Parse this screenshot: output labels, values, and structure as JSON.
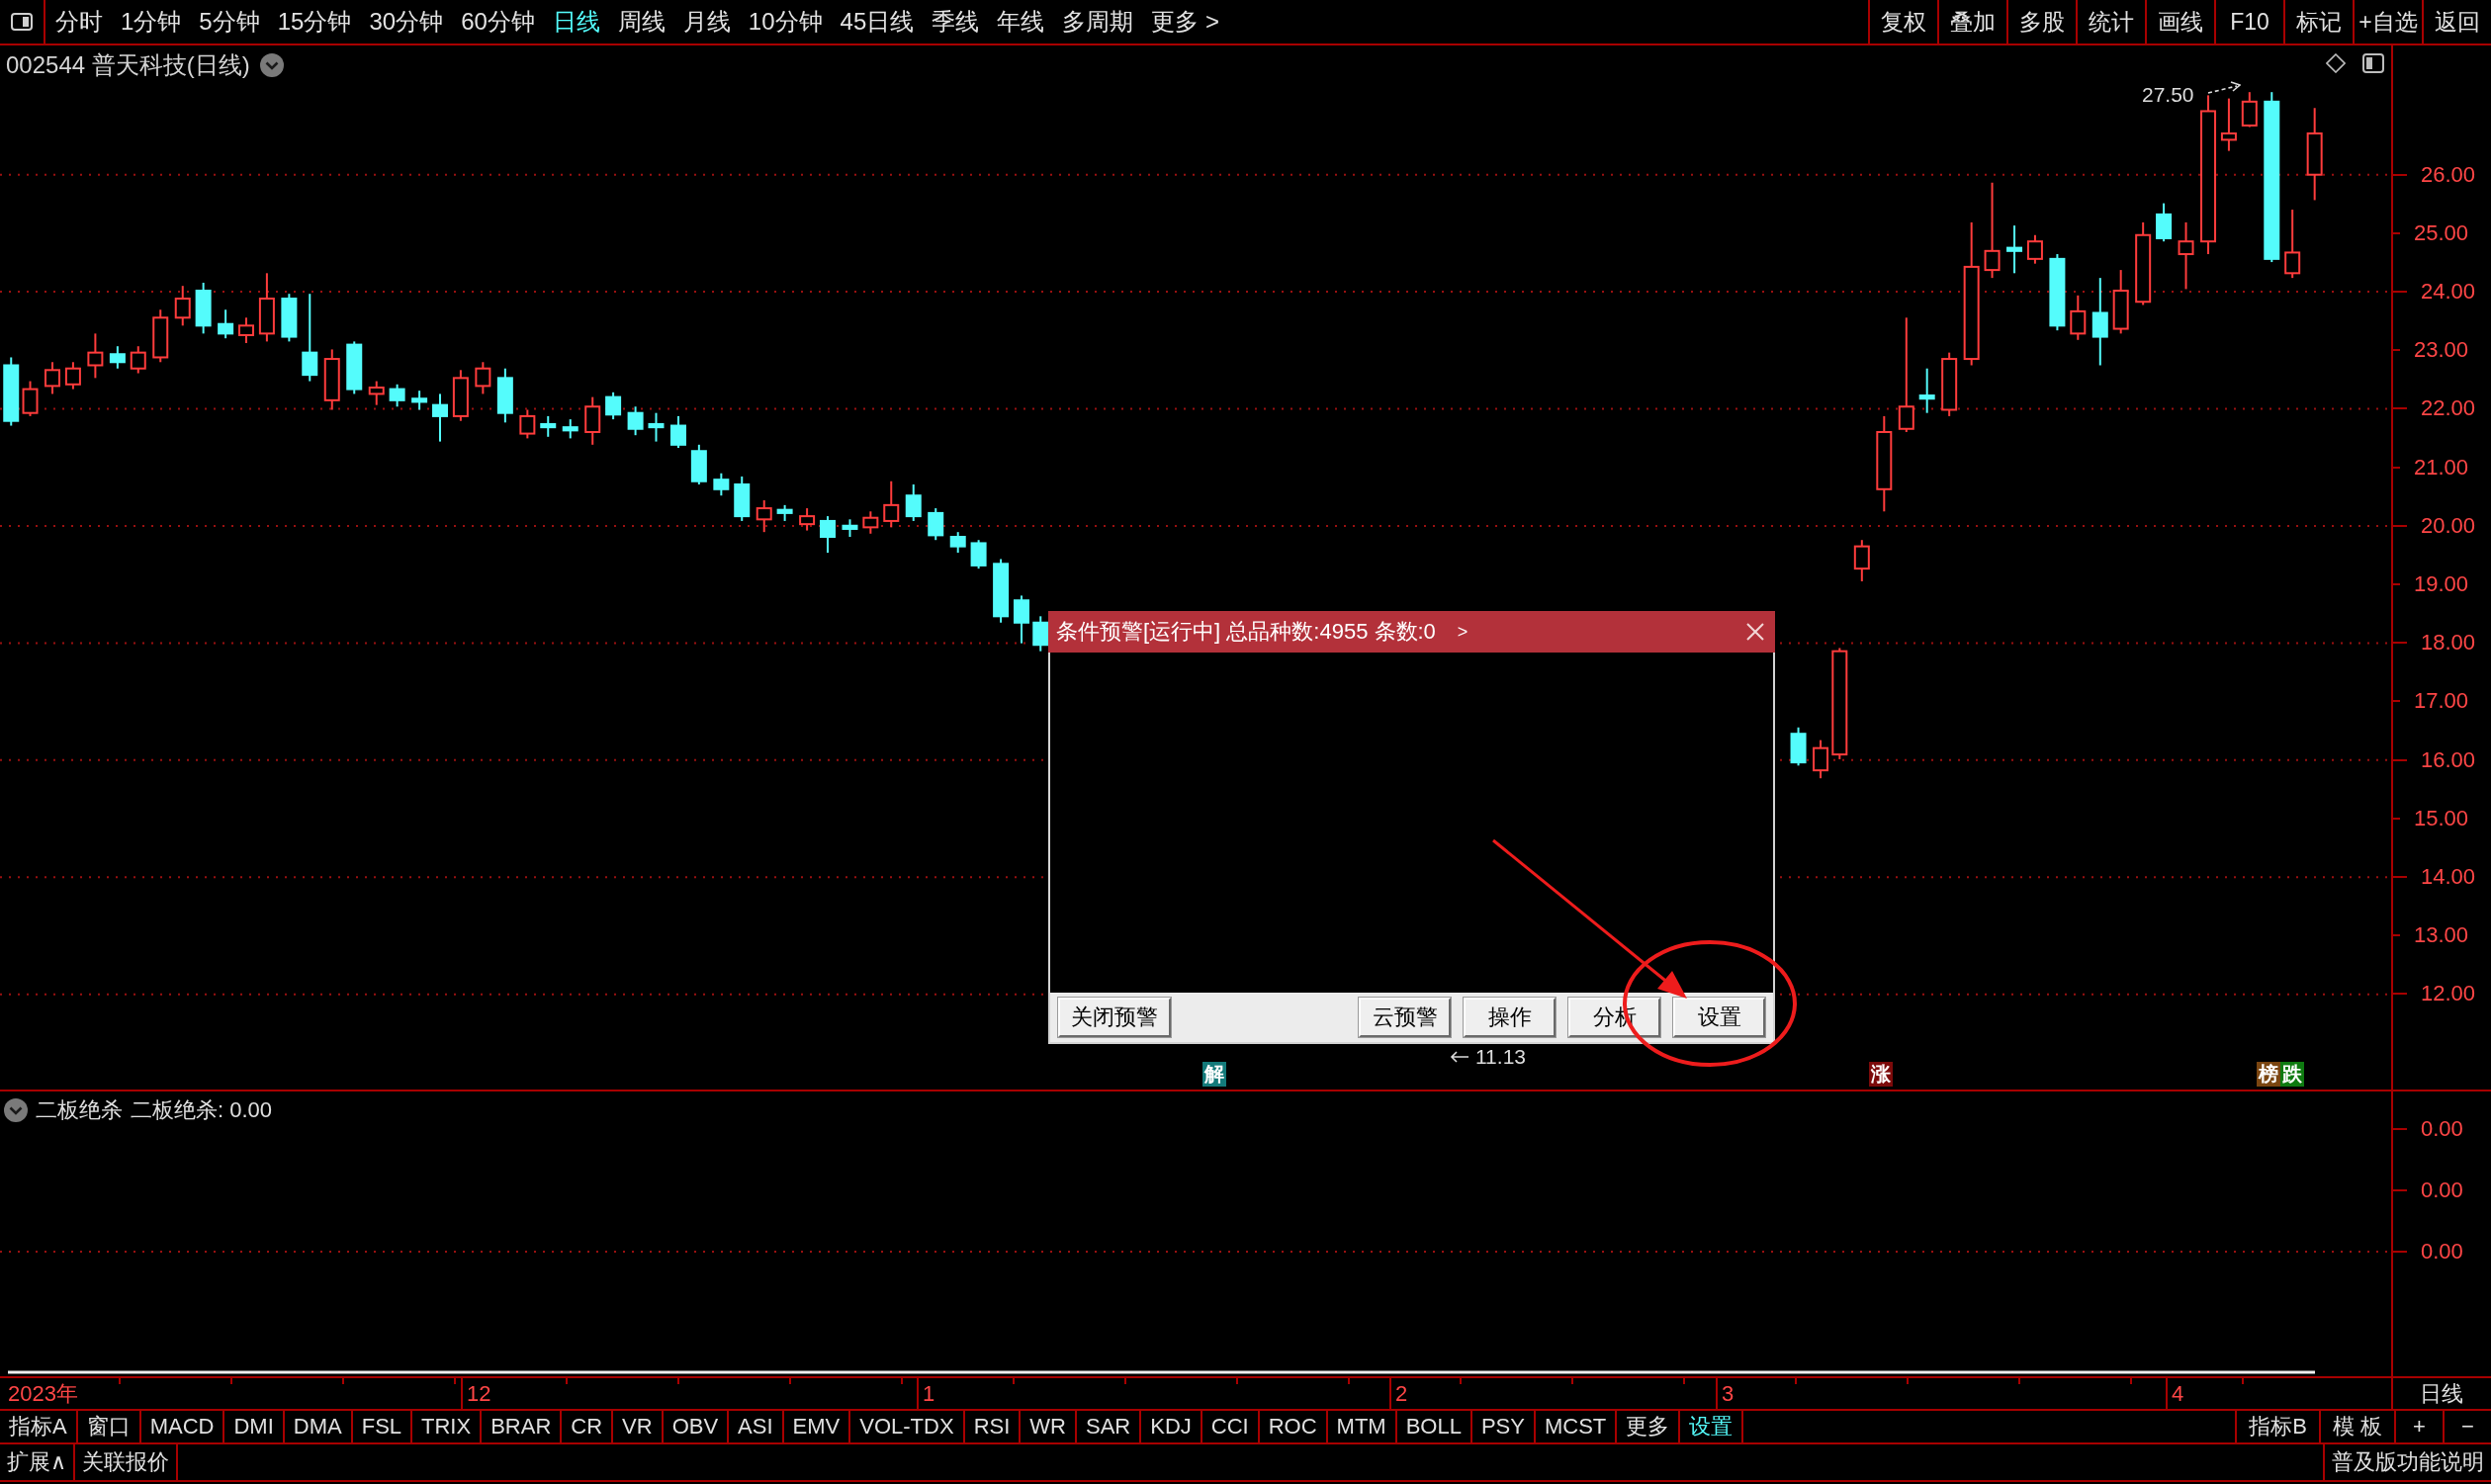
{
  "toolbar": {
    "periods": [
      {
        "label": "分时",
        "selected": false
      },
      {
        "label": "1分钟",
        "selected": false
      },
      {
        "label": "5分钟",
        "selected": false
      },
      {
        "label": "15分钟",
        "selected": false
      },
      {
        "label": "30分钟",
        "selected": false
      },
      {
        "label": "60分钟",
        "selected": false
      },
      {
        "label": "日线",
        "selected": true
      },
      {
        "label": "周线",
        "selected": false
      },
      {
        "label": "月线",
        "selected": false
      },
      {
        "label": "10分钟",
        "selected": false
      },
      {
        "label": "45日线",
        "selected": false
      },
      {
        "label": "季线",
        "selected": false
      },
      {
        "label": "年线",
        "selected": false
      },
      {
        "label": "多周期",
        "selected": false
      },
      {
        "label": "更多 >",
        "selected": false
      }
    ],
    "tools": [
      "复权",
      "叠加",
      "多股",
      "统计",
      "画线",
      "F10",
      "标记",
      "+自选",
      "返回"
    ]
  },
  "chart": {
    "title": "002544 普天科技(日线)",
    "high_marker": "27.50",
    "low_marker": "11.13",
    "price_axis": [
      "26.00",
      "25.00",
      "24.00",
      "23.00",
      "22.00",
      "21.00",
      "20.00",
      "19.00",
      "18.00",
      "17.00",
      "16.00",
      "15.00",
      "14.00",
      "13.00",
      "12.00"
    ],
    "event_tags": [
      {
        "label": "解",
        "color": "#137a7a"
      },
      {
        "label": "涨",
        "color": "#7c0a0a"
      },
      {
        "label": "榜",
        "color": "#7a4510"
      },
      {
        "label": "跌",
        "color": "#0e7a10"
      }
    ]
  },
  "alert_dialog": {
    "title": "条件预警[运行中] 总品种数:4955 条数:0",
    "expand": ">",
    "buttons_left": [
      "关闭预警"
    ],
    "buttons_right": [
      "云预警",
      "操作",
      "分析",
      "设置"
    ]
  },
  "indicator_pane": {
    "name": "二板绝杀",
    "reading": "二板绝杀: 0.00",
    "axis": [
      "0.00",
      "0.00",
      "0.00"
    ]
  },
  "date_axis": {
    "labels": [
      "2023年",
      "12",
      "1",
      "2",
      "3",
      "4"
    ],
    "period": "日线"
  },
  "indicator_tabs": [
    {
      "label": "指标A",
      "selected": false
    },
    {
      "label": "窗口",
      "selected": false
    },
    {
      "label": "MACD",
      "selected": false
    },
    {
      "label": "DMI",
      "selected": false
    },
    {
      "label": "DMA",
      "selected": false
    },
    {
      "label": "FSL",
      "selected": false
    },
    {
      "label": "TRIX",
      "selected": false
    },
    {
      "label": "BRAR",
      "selected": false
    },
    {
      "label": "CR",
      "selected": false
    },
    {
      "label": "VR",
      "selected": false
    },
    {
      "label": "OBV",
      "selected": false
    },
    {
      "label": "ASI",
      "selected": false
    },
    {
      "label": "EMV",
      "selected": false
    },
    {
      "label": "VOL-TDX",
      "selected": false
    },
    {
      "label": "RSI",
      "selected": false
    },
    {
      "label": "WR",
      "selected": false
    },
    {
      "label": "SAR",
      "selected": false
    },
    {
      "label": "KDJ",
      "selected": false
    },
    {
      "label": "CCI",
      "selected": false
    },
    {
      "label": "ROC",
      "selected": false
    },
    {
      "label": "MTM",
      "selected": false
    },
    {
      "label": "BOLL",
      "selected": false
    },
    {
      "label": "PSY",
      "selected": false
    },
    {
      "label": "MCST",
      "selected": false
    },
    {
      "label": "更多",
      "selected": false
    },
    {
      "label": "设置",
      "selected": true
    }
  ],
  "indicator_tabs_right": [
    "指标B",
    "模 板",
    "+",
    "−"
  ],
  "status_bar": {
    "left": [
      "扩展∧",
      "关联报价"
    ],
    "right": "普及版功能说明"
  }
}
